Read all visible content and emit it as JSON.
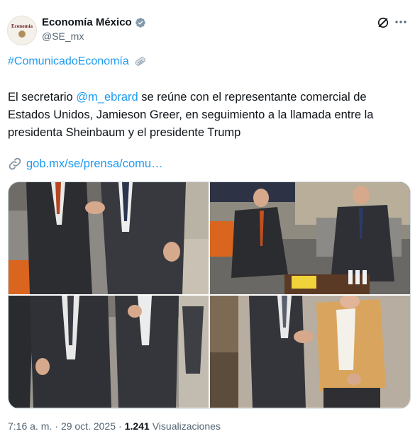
{
  "account": {
    "name": "Economía México",
    "handle": "@SE_mx",
    "avatar_text": "Economía"
  },
  "tweet": {
    "hashtag": "#ComunicadoEconomía",
    "text_before_mention": "El secretario ",
    "mention": "@m_ebrard",
    "text_after_mention": " se reúne con el representante comercial de Estados Unidos, Jamieson Greer, en seguimiento a la llamada entre la presidenta Sheinbaum y el presidente Trump",
    "link": "gob.mx/se/prensa/comu…"
  },
  "meta": {
    "time": "7:16 a. m.",
    "separator1": "·",
    "date": "29 oct. 2025",
    "separator2": "·",
    "views_count": "1.241",
    "views_label": "Visualizaciones"
  },
  "icons": {
    "verified": "verified-badge-icon",
    "grok": "grok-icon",
    "more": "more-icon",
    "news": "rolled-newspaper-icon",
    "link": "link-icon"
  },
  "colors": {
    "accent": "#1d9bf0",
    "text": "#0f1419",
    "muted": "#536471",
    "border": "#cfd9de"
  }
}
